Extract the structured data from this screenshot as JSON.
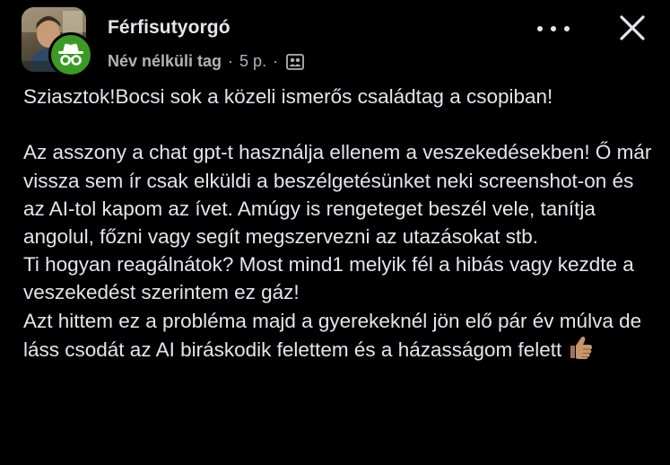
{
  "post": {
    "author": "Férfisutyorgó",
    "author_tag": "Név nélküli tag",
    "separator": "·",
    "time": "5 p.",
    "privacy_icon": "group-icon",
    "paragraphs": [
      "Sziasztok!Bocsi sok a közeli ismerős családtag a csopiban!",
      "",
      "Az asszony a chat gpt-t használja ellenem a veszekedésekben! Ő már vissza sem ír csak elküldi a beszélgetésünket neki screenshot-on és az AI-tol kapom az ívet. Amúgy is rengeteget beszél vele, tanítja angolul, főzni vagy segít megszervezni az utazásokat stb.",
      "Ti hogyan reagálnátok? Most mind1 melyik fél a hibás vagy kezdte a veszekedést szerintem ez gáz!",
      "Azt hittem ez a probléma majd a gyerekeknél jön elő pár év múlva de láss csodát az AI biráskodik felettem és a házasságom felett"
    ],
    "closing_emoji": "thumbs-up-icon"
  },
  "icons": {
    "more": "more-options-icon",
    "close": "close-icon",
    "anonymous": "anonymous-member-icon"
  },
  "colors": {
    "background": "#000000",
    "text": "#e4e6eb",
    "secondary_text": "#b0b3b8",
    "anonymous_badge": "#3a9a25"
  }
}
